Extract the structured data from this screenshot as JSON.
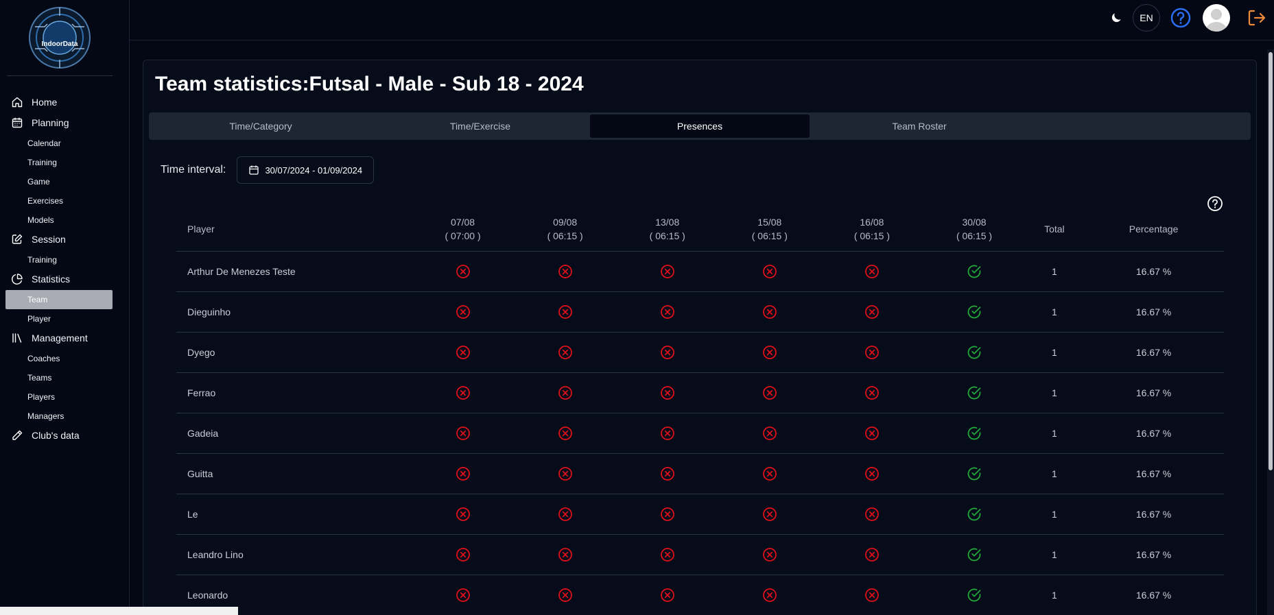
{
  "app": {
    "logo_text": "IndoorData"
  },
  "sidebar": {
    "sections": [
      {
        "label": "Home",
        "icon": "home-icon",
        "children": []
      },
      {
        "label": "Planning",
        "icon": "calendar-icon",
        "children": [
          "Calendar",
          "Training",
          "Game",
          "Exercises",
          "Models"
        ]
      },
      {
        "label": "Session",
        "icon": "edit-icon",
        "children": [
          "Training"
        ]
      },
      {
        "label": "Statistics",
        "icon": "pie-chart-icon",
        "children": [
          "Team",
          "Player"
        ]
      },
      {
        "label": "Management",
        "icon": "library-icon",
        "children": [
          "Coaches",
          "Teams",
          "Players",
          "Managers"
        ]
      },
      {
        "label": "Club's data",
        "icon": "pencil-icon",
        "children": []
      }
    ],
    "active_item": "Team"
  },
  "topbar": {
    "language": "EN",
    "icons": [
      "moon-icon",
      "help-icon",
      "avatar",
      "logout-icon"
    ]
  },
  "page": {
    "title": "Team statistics:Futsal - Male - Sub 18 - 2024",
    "tabs": [
      "Time/Category",
      "Time/Exercise",
      "Presences",
      "Team Roster"
    ],
    "active_tab": "Presences",
    "interval_label": "Time interval:",
    "interval_value": "30/07/2024 - 01/09/2024"
  },
  "table": {
    "player_header": "Player",
    "dates": [
      {
        "date": "07/08",
        "time": "( 07:00 )"
      },
      {
        "date": "09/08",
        "time": "( 06:15 )"
      },
      {
        "date": "13/08",
        "time": "( 06:15 )"
      },
      {
        "date": "15/08",
        "time": "( 06:15 )"
      },
      {
        "date": "16/08",
        "time": "( 06:15 )"
      },
      {
        "date": "30/08",
        "time": "( 06:15 )"
      }
    ],
    "total_header": "Total",
    "percentage_header": "Percentage",
    "rows": [
      {
        "player": "Arthur De Menezes Teste",
        "presences": [
          false,
          false,
          false,
          false,
          false,
          true
        ],
        "total": "1",
        "percentage": "16.67 %"
      },
      {
        "player": "Dieguinho",
        "presences": [
          false,
          false,
          false,
          false,
          false,
          true
        ],
        "total": "1",
        "percentage": "16.67 %"
      },
      {
        "player": "Dyego",
        "presences": [
          false,
          false,
          false,
          false,
          false,
          true
        ],
        "total": "1",
        "percentage": "16.67 %"
      },
      {
        "player": "Ferrao",
        "presences": [
          false,
          false,
          false,
          false,
          false,
          true
        ],
        "total": "1",
        "percentage": "16.67 %"
      },
      {
        "player": "Gadeia",
        "presences": [
          false,
          false,
          false,
          false,
          false,
          true
        ],
        "total": "1",
        "percentage": "16.67 %"
      },
      {
        "player": "Guitta",
        "presences": [
          false,
          false,
          false,
          false,
          false,
          true
        ],
        "total": "1",
        "percentage": "16.67 %"
      },
      {
        "player": "Le",
        "presences": [
          false,
          false,
          false,
          false,
          false,
          true
        ],
        "total": "1",
        "percentage": "16.67 %"
      },
      {
        "player": "Leandro Lino",
        "presences": [
          false,
          false,
          false,
          false,
          false,
          true
        ],
        "total": "1",
        "percentage": "16.67 %"
      },
      {
        "player": "Leonardo",
        "presences": [
          false,
          false,
          false,
          false,
          false,
          true
        ],
        "total": "1",
        "percentage": "16.67 %"
      }
    ]
  },
  "colors": {
    "absent": "#e0101a",
    "present": "#22a83a",
    "help": "#2a6df0",
    "logout": "#f08a3c"
  }
}
